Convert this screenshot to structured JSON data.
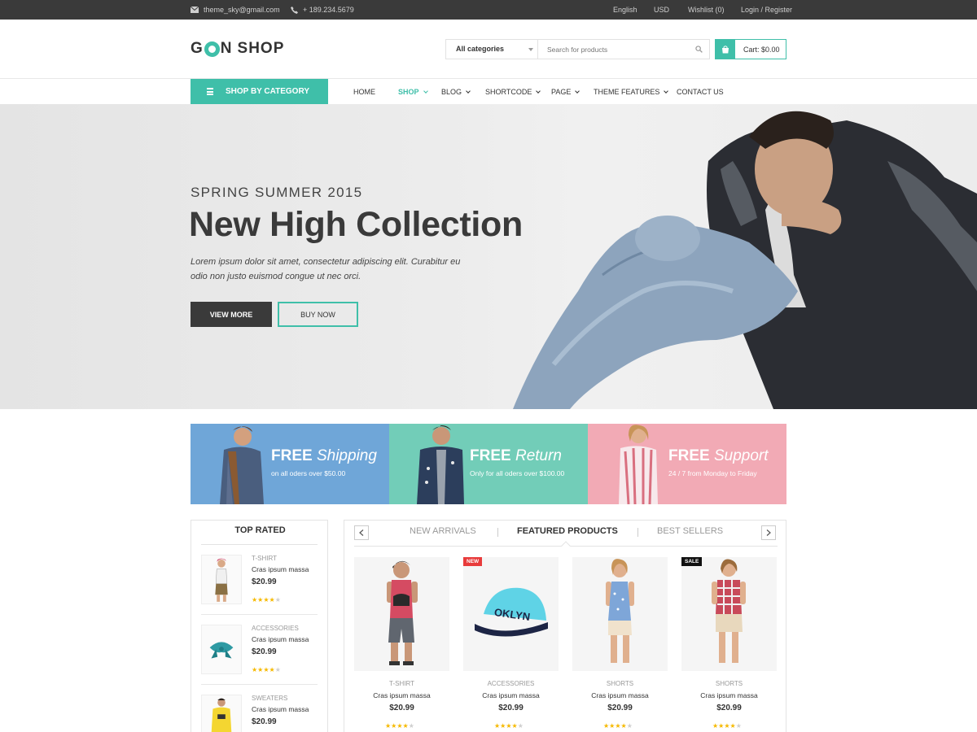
{
  "colors": {
    "accent": "#3fbfa9",
    "dark": "#3a3a3a",
    "star": "#f6b900",
    "new_badge": "#e83b3b",
    "sale_badge": "#111111"
  },
  "topbar": {
    "email": "theme_sky@gmail.com",
    "phone": "+ 189.234.5679",
    "language": "English",
    "currency": "USD",
    "wishlist": "Wishlist (0)",
    "account": "Login / Register"
  },
  "header": {
    "logo": {
      "part1": "G",
      "part2": "N",
      "part3": "SHOP"
    },
    "search": {
      "category": "All categories",
      "placeholder": "Search for products"
    },
    "cart": {
      "label": "Cart: $0.00"
    }
  },
  "nav": {
    "category_button": "SHOP BY CATEGORY",
    "items": [
      {
        "label": "HOME",
        "has_dropdown": false,
        "active": false
      },
      {
        "label": "SHOP",
        "has_dropdown": true,
        "active": true
      },
      {
        "label": "BLOG",
        "has_dropdown": true,
        "active": false
      },
      {
        "label": "SHORTCODE",
        "has_dropdown": true,
        "active": false
      },
      {
        "label": "PAGE",
        "has_dropdown": true,
        "active": false
      },
      {
        "label": "THEME FEATURES",
        "has_dropdown": true,
        "active": false
      },
      {
        "label": "CONTACT US",
        "has_dropdown": false,
        "active": false
      }
    ]
  },
  "hero": {
    "kicker": "SPRING SUMMER 2015",
    "title": "New High Collection",
    "description": "Lorem ipsum dolor sit amet, consectetur adipiscing elit. Curabitur eu odio non justo euismod congue ut nec orci.",
    "primary_button": "VIEW MORE",
    "secondary_button": "BUY NOW"
  },
  "promos": [
    {
      "bold": "FREE",
      "italic": "Shipping",
      "sub": "on all oders over $50.00",
      "color": "#6fa6d8"
    },
    {
      "bold": "FREE",
      "italic": "Return",
      "sub": "Only for all oders over $100.00",
      "color": "#72cdb8"
    },
    {
      "bold": "FREE",
      "italic": "Support",
      "sub": "24 / 7 from Monday to Friday",
      "color": "#f2aab5"
    }
  ],
  "top_rated": {
    "title": "TOP RATED",
    "items": [
      {
        "category": "T-SHIRT",
        "name": "Cras ipsum massa",
        "price": "$20.99",
        "rating": 4
      },
      {
        "category": "ACCESSORIES",
        "name": "Cras ipsum massa",
        "price": "$20.99",
        "rating": 4
      },
      {
        "category": "SWEATERS",
        "name": "Cras ipsum massa",
        "price": "$20.99",
        "rating": 4
      }
    ]
  },
  "products": {
    "tabs": [
      "NEW ARRIVALS",
      "FEATURED PRODUCTS",
      "BEST SELLERS"
    ],
    "active_tab": "FEATURED PRODUCTS",
    "items": [
      {
        "category": "T-SHIRT",
        "name": "Cras ipsum massa",
        "price": "$20.99",
        "rating": 4,
        "badge": ""
      },
      {
        "category": "ACCESSORIES",
        "name": "Cras ipsum massa",
        "price": "$20.99",
        "rating": 4,
        "badge": "NEW",
        "image_text": "OKLYN"
      },
      {
        "category": "SHORTS",
        "name": "Cras ipsum massa",
        "price": "$20.99",
        "rating": 4,
        "badge": ""
      },
      {
        "category": "SHORTS",
        "name": "Cras ipsum massa",
        "price": "$20.99",
        "rating": 4,
        "badge": "SALE"
      }
    ]
  }
}
